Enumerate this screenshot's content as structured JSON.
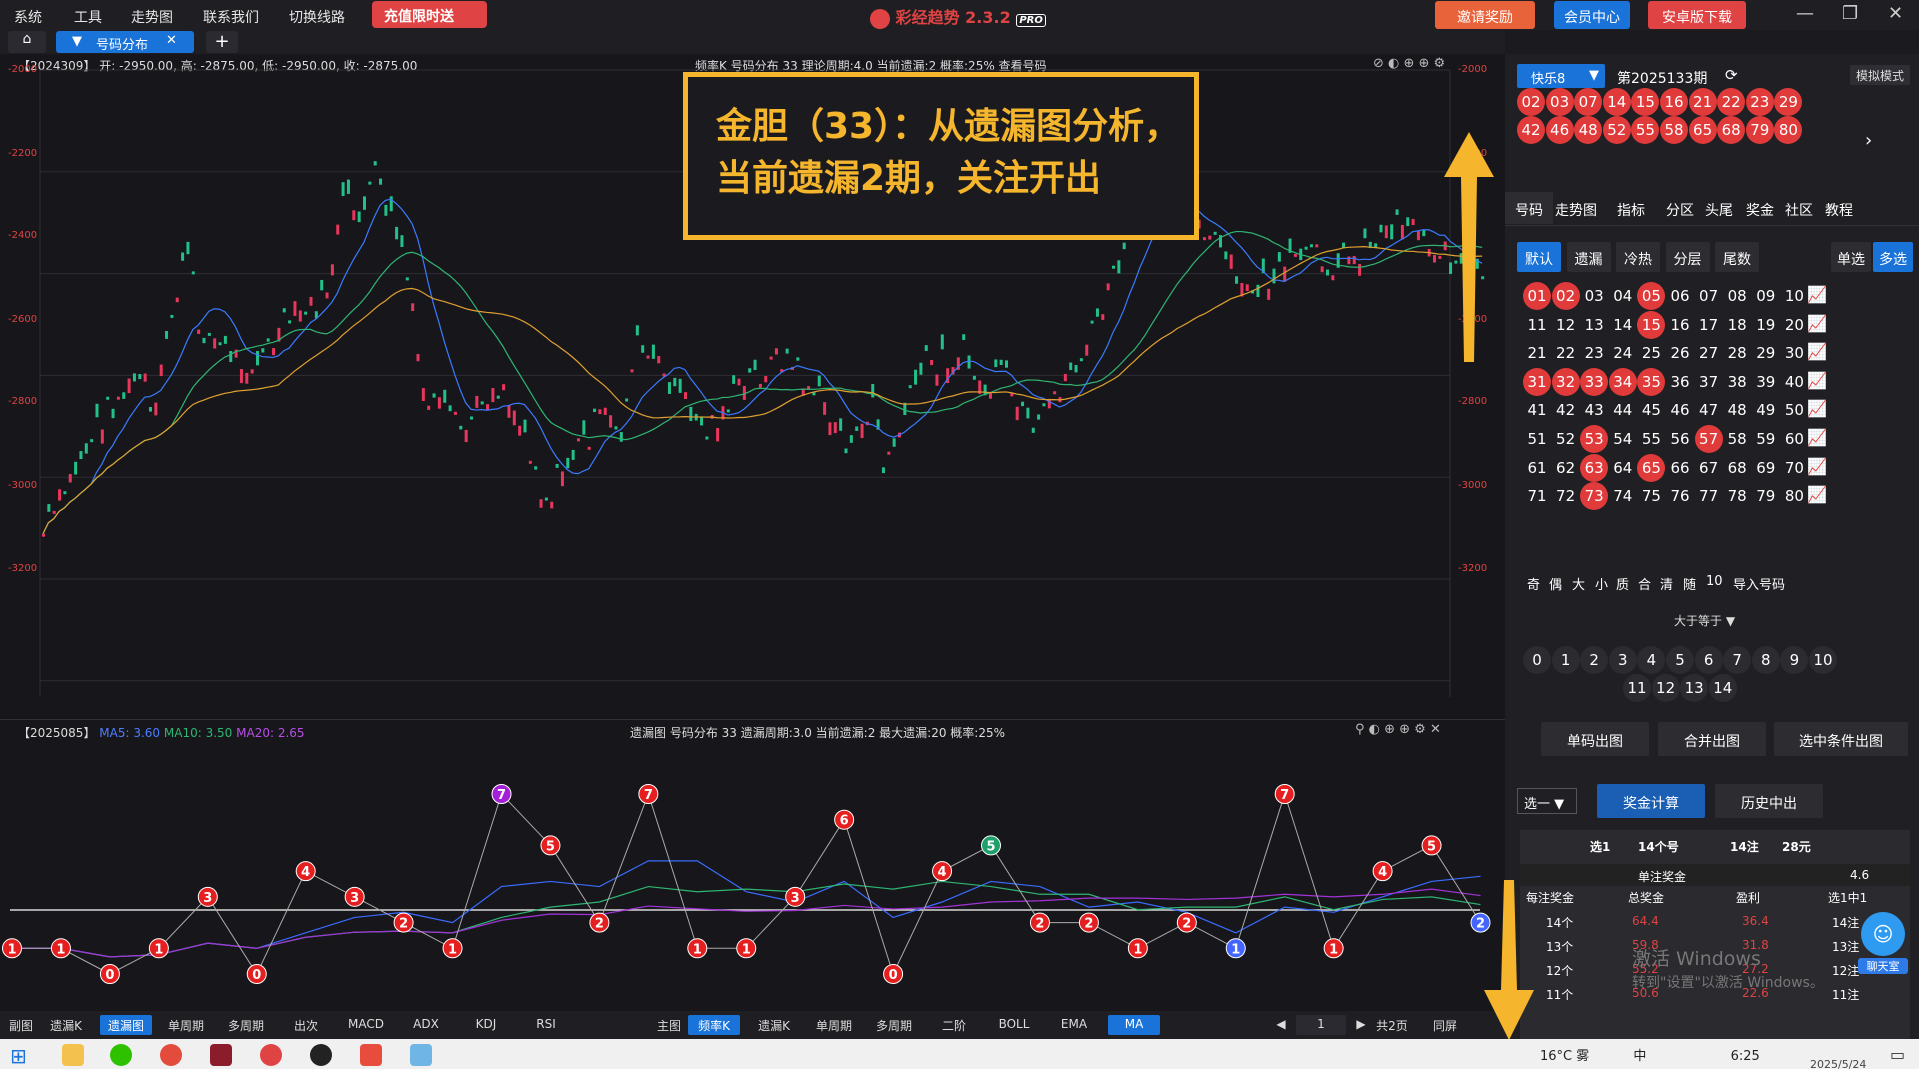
{
  "topbar": {
    "menus": [
      "系统",
      "工具",
      "走势图",
      "联系我们",
      "切换线路"
    ],
    "charge": "充值限时送",
    "app_name": "彩经趋势",
    "version": "2.3.2",
    "pro": "PRO",
    "invite": "邀请奖励",
    "member": "会员中心",
    "android": "安卓版下载"
  },
  "tabs": {
    "active": "号码分布"
  },
  "upper_chart": {
    "info_left": "【2024309】 开: -2950.00, 高: -2875.00, 低: -2950.00, 收: -2875.00",
    "info_right": "频率K  号码分布  33    理论周期:4.0  当前遗漏:2  概率:25%    查看号码",
    "y_ticks": [
      "-2000",
      "-2200",
      "-2400",
      "-2600",
      "-2800",
      "-3000",
      "-3200"
    ]
  },
  "callout": {
    "line1": "金胆（33）：从遗漏图分析，",
    "line2": "当前遗漏2期，关注开出"
  },
  "lower_chart": {
    "info_left_id": "【2025085】",
    "ma5": "MA5: 3.60",
    "ma10": "MA10: 3.50",
    "ma20": "MA20: 2.65",
    "info_right": "遗漏图  号码分布  33    遗漏周期:3.0  当前遗漏:2  最大遗漏:20  概率:25%"
  },
  "chart_data": {
    "type": "line",
    "title": "遗漏图",
    "values": [
      1,
      1,
      0,
      1,
      3,
      0,
      4,
      3,
      2,
      1,
      7,
      5,
      2,
      7,
      1,
      1,
      3,
      6,
      0,
      4,
      5,
      2,
      2,
      1,
      2,
      1,
      7,
      1,
      4,
      5,
      2
    ],
    "ylim": [
      0,
      7
    ]
  },
  "bottombar": {
    "left_label": "副图",
    "left_buttons": [
      "遗漏K",
      "遗漏图",
      "单周期",
      "多周期",
      "出次",
      "MACD",
      "ADX",
      "KDJ",
      "RSI"
    ],
    "left_active": "遗漏图",
    "main_label": "主图",
    "main_buttons": [
      "频率K",
      "遗漏K",
      "单周期",
      "多周期",
      "二阶",
      "BOLL",
      "EMA",
      "MA"
    ],
    "page": "1",
    "total_pages": "共2页",
    "sync": "同屏"
  },
  "right_panel": {
    "lottery": "快乐8",
    "issue": "第2025133期",
    "sim": "模拟模式",
    "drawn_row1": [
      "02",
      "03",
      "07",
      "14",
      "15",
      "16",
      "21",
      "22",
      "23",
      "29"
    ],
    "drawn_row2": [
      "42",
      "46",
      "48",
      "52",
      "55",
      "58",
      "65",
      "68",
      "79",
      "80"
    ],
    "nav_tabs": [
      "号码",
      "走势图",
      "指标",
      "分区",
      "头尾",
      "奖金",
      "社区",
      "教程"
    ],
    "filters": [
      "默认",
      "遗漏",
      "冷热",
      "分层",
      "尾数"
    ],
    "single": "单选",
    "multi": "多选",
    "numbers": [
      "01",
      "02",
      "03",
      "04",
      "05",
      "06",
      "07",
      "08",
      "09",
      "10",
      "11",
      "12",
      "13",
      "14",
      "15",
      "16",
      "17",
      "18",
      "19",
      "20",
      "21",
      "22",
      "23",
      "24",
      "25",
      "26",
      "27",
      "28",
      "29",
      "30",
      "31",
      "32",
      "33",
      "34",
      "35",
      "36",
      "37",
      "38",
      "39",
      "40",
      "41",
      "42",
      "43",
      "44",
      "45",
      "46",
      "47",
      "48",
      "49",
      "50",
      "51",
      "52",
      "53",
      "54",
      "55",
      "56",
      "57",
      "58",
      "59",
      "60",
      "61",
      "62",
      "63",
      "64",
      "65",
      "66",
      "67",
      "68",
      "69",
      "70",
      "71",
      "72",
      "73",
      "74",
      "75",
      "76",
      "77",
      "78",
      "79",
      "80"
    ],
    "selected": [
      "01",
      "02",
      "05",
      "15",
      "31",
      "32",
      "33",
      "34",
      "35",
      "53",
      "57",
      "63",
      "65",
      "73"
    ],
    "small_btns": [
      "奇",
      "偶",
      "大",
      "小",
      "质",
      "合",
      "清",
      "随",
      "10",
      "导入号码"
    ],
    "geq": "大于等于",
    "count_row1": [
      "0",
      "1",
      "2",
      "3",
      "4",
      "5",
      "6",
      "7",
      "8",
      "9",
      "10"
    ],
    "count_row2": [
      "11",
      "12",
      "13",
      "14"
    ],
    "actions": [
      "单码出图",
      "合并出图",
      "选中条件出图"
    ],
    "pick": "选一",
    "calc": "奖金计算",
    "history": "历史中出",
    "table": {
      "summary": [
        "选1",
        "14个号",
        "14注",
        "28元"
      ],
      "prize_label": "单注奖金",
      "prize_value": "4.6",
      "headers": [
        "每注奖金",
        "总奖金",
        "盈利",
        "选1中1"
      ],
      "rows": [
        [
          "14个",
          "64.4",
          "36.4",
          "14注"
        ],
        [
          "13个",
          "59.8",
          "31.8",
          "13注"
        ],
        [
          "12个",
          "55.2",
          "27.2",
          "12注"
        ],
        [
          "11个",
          "50.6",
          "22.6",
          "11注"
        ]
      ]
    },
    "chat": "聊天室"
  },
  "watermark": {
    "line1": "激活 Windows",
    "line2": "转到\"设置\"以激活 Windows。"
  },
  "taskbar": {
    "temp": "16°C",
    "weather": "雾",
    "ime": "中",
    "time": "6:25",
    "date": "2025/5/24"
  }
}
